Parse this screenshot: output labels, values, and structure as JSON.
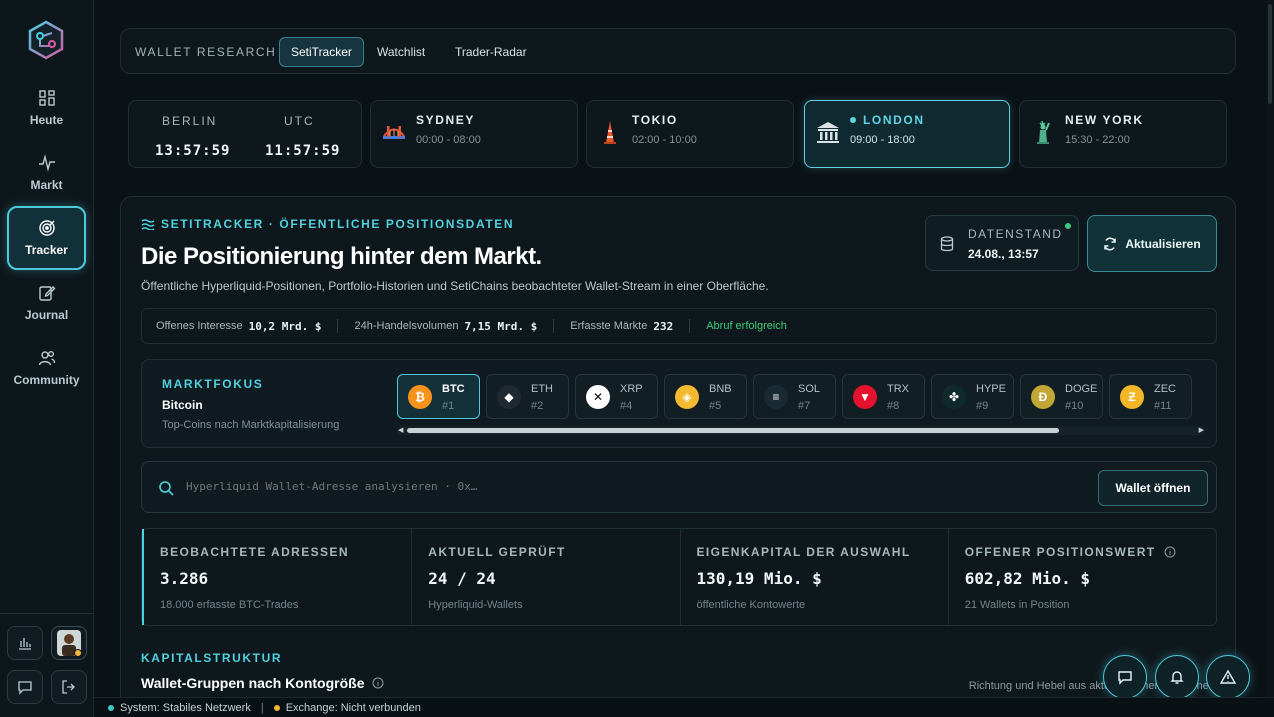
{
  "sidebar": {
    "items": [
      {
        "label": "Heute",
        "icon": "grid-icon"
      },
      {
        "label": "Markt",
        "icon": "pulse-icon"
      },
      {
        "label": "Tracker",
        "icon": "target-icon",
        "active": true
      },
      {
        "label": "Journal",
        "icon": "edit-icon"
      },
      {
        "label": "Community",
        "icon": "users-icon"
      }
    ]
  },
  "tabs_panel": {
    "title": "WALLET RESEARCH",
    "tabs": [
      "SetiTracker",
      "Watchlist",
      "Trader-Radar"
    ],
    "active": "SetiTracker"
  },
  "clocks": {
    "berlin": {
      "label": "BERLIN",
      "time": "13:57:59"
    },
    "utc": {
      "label": "UTC",
      "time": "11:57:59"
    }
  },
  "sessions": [
    {
      "name": "SYDNEY",
      "hours": "00:00 - 08:00",
      "icon": "bridge-icon"
    },
    {
      "name": "TOKIO",
      "hours": "02:00 - 10:00",
      "icon": "tower-icon"
    },
    {
      "name": "LONDON",
      "hours": "09:00 - 18:00",
      "icon": "bank-icon",
      "active": true
    },
    {
      "name": "NEW YORK",
      "hours": "15:30 - 22:00",
      "icon": "liberty-icon"
    }
  ],
  "main": {
    "eyebrow": "SETITRACKER · ÖFFENTLICHE POSITIONSDATEN",
    "headline": "Die Positionierung hinter dem Markt.",
    "subline": "Öffentliche Hyperliquid-Positionen, Portfolio-Historien und SetiChains beobachteter Wallet-Stream in einer Oberfläche.",
    "datestand_label": "DATENSTAND",
    "datestand_value": "24.08., 13:57",
    "refresh_label": "Aktualisieren"
  },
  "stats_strip": {
    "oi_label": "Offenes Interesse",
    "oi_value": "10,2 Mrd. $",
    "vol_label": "24h-Handelsvolumen",
    "vol_value": "7,15 Mrd. $",
    "markets_label": "Erfasste Märkte",
    "markets_value": "232",
    "status": "Abruf erfolgreich"
  },
  "marktfokus": {
    "title": "MARKTFOKUS",
    "selected": "Bitcoin",
    "desc": "Top-Coins nach Marktkapitalisierung",
    "coins": [
      {
        "sym": "BTC",
        "rank": "#1",
        "color": "#f7931a",
        "glyph": "₿"
      },
      {
        "sym": "ETH",
        "rank": "#2",
        "color": "#1e2a30",
        "glyph": "◆"
      },
      {
        "sym": "XRP",
        "rank": "#4",
        "color": "#ffffff",
        "glyph": "✕"
      },
      {
        "sym": "BNB",
        "rank": "#5",
        "color": "#f3ba2f",
        "glyph": "◈"
      },
      {
        "sym": "SOL",
        "rank": "#7",
        "color": "#1a2a33",
        "glyph": "≡"
      },
      {
        "sym": "TRX",
        "rank": "#8",
        "color": "#e5112d",
        "glyph": "▼"
      },
      {
        "sym": "HYPE",
        "rank": "#9",
        "color": "#0f2a2a",
        "glyph": "✤"
      },
      {
        "sym": "DOGE",
        "rank": "#10",
        "color": "#c2a633",
        "glyph": "Ð"
      },
      {
        "sym": "ZEC",
        "rank": "#11",
        "color": "#f4b728",
        "glyph": "Ƶ"
      }
    ]
  },
  "search": {
    "placeholder": "Hyperliquid Wallet-Adresse analysieren · 0x…",
    "button": "Wallet öffnen"
  },
  "metrics": [
    {
      "label": "BEOBACHTETE ADRESSEN",
      "value": "3.286",
      "note": "18.000 erfasste BTC-Trades"
    },
    {
      "label": "AKTUELL GEPRÜFT",
      "value": "24 / 24",
      "note": "Hyperliquid-Wallets"
    },
    {
      "label": "EIGENKAPITAL DER AUSWAHL",
      "value": "130,19 Mio. $",
      "note": "öffentliche Kontowerte"
    },
    {
      "label": "OFFENER POSITIONSWERT",
      "value": "602,82 Mio. $",
      "note": "21 Wallets in Position"
    }
  ],
  "capital": {
    "title": "KAPITALSTRUKTUR",
    "subtitle": "Wallet-Gruppen nach Kontogröße",
    "right_note": "Richtung und Hebel aus aktuell offenen Positionen"
  },
  "status_bar": {
    "system": "System: Stabiles Netzwerk",
    "exchange": "Exchange: Nicht verbunden",
    "system_color": "#3ec9c9",
    "exchange_color": "#f3b73a"
  }
}
